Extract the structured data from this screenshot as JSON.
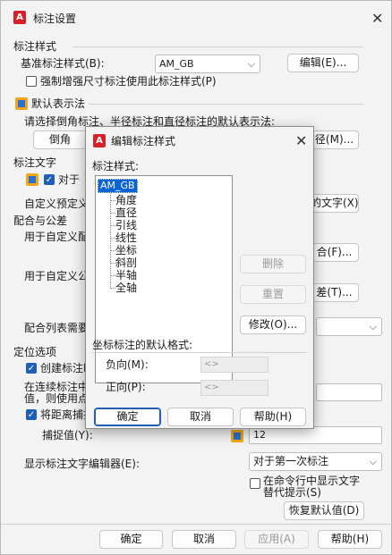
{
  "main": {
    "title": "标注设置",
    "sections": {
      "dim_style": "标注样式",
      "default_rep": "默认表示法",
      "dim_text": "标注文字",
      "fit_tol": "配合与公差",
      "position": "定位选项"
    },
    "base_style_label": "基准标注样式(B):",
    "base_style_value": "AM_GB",
    "edit_button": "编辑(E)...",
    "force_checkbox": "强制增强尺寸标注使用此标注样式(P)",
    "default_rep_prompt": "请选择倒角标注、半径标注和直径标注的默认表示法:",
    "chamfer_button": "倒角",
    "diameter_button": "径(M)...",
    "to_label": "对于",
    "custom_text_label": "自定义预定义",
    "text_button": "的文字(X)...",
    "custom_fit_label": "用于自定义配",
    "fit_button": "合(F)...",
    "custom_tol_label": "用于自定义公",
    "tol_button": "差(T)...",
    "fit_list_label": "配合列表需要",
    "create_label": "创建标注时",
    "continuous_line1": "在连续标注中",
    "continuous_line2": "值，则使用点",
    "snap_checkbox": "将距离捕捉",
    "snap_value_label": "捕捉值(Y):",
    "snap_value": "12",
    "show_editor_label": "显示标注文字编辑器(E):",
    "show_editor_value": "对于第一次标注",
    "cmdline_checkbox_line1": "在命令行中显示文字",
    "cmdline_checkbox_line2": "替代提示(S)",
    "restore_button": "恢复默认值(D)",
    "ok_button": "确定",
    "cancel_button": "取消",
    "apply_button": "应用(A)",
    "help_button": "帮助(H)"
  },
  "modal": {
    "title": "编辑标注样式",
    "styles_label": "标注样式:",
    "tree_root": "AM_GB",
    "tree_children": [
      "角度",
      "直径",
      "引线",
      "线性",
      "坐标",
      "斜剖",
      "半轴",
      "全轴"
    ],
    "delete_button": "删除",
    "reset_button": "重置",
    "modify_button": "修改(O)...",
    "coord_format_label": "坐标标注的默认格式:",
    "negative_label": "负向(M):",
    "negative_value": "<>",
    "positive_label": "正向(P):",
    "positive_value": "<>",
    "ok_button": "确定",
    "cancel_button": "取消",
    "help_button": "帮助(H)"
  }
}
